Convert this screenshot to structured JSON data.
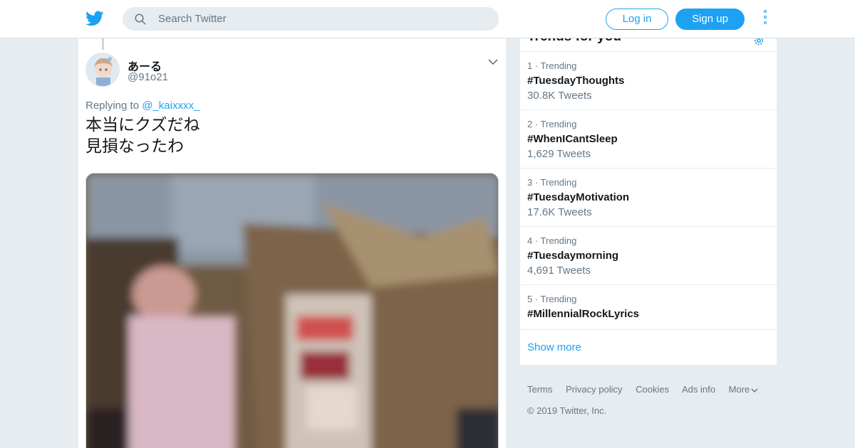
{
  "header": {
    "logo_icon": "twitter-bird-icon",
    "search_placeholder": "Search Twitter",
    "login_label": "Log in",
    "signup_label": "Sign up",
    "accent_color": "#1da1f2"
  },
  "tweet": {
    "display_name": "あーる",
    "handle": "@91o21",
    "replying_prefix": "Replying to",
    "replying_to": "@_kaixxxx_",
    "text_line1": "本当にクズだね",
    "text_line2": "見損なったわ"
  },
  "trends": {
    "title": "Trends for you",
    "items": [
      {
        "meta": "1 · Trending",
        "name": "#TuesdayThoughts",
        "count": "30.8K Tweets"
      },
      {
        "meta": "2 · Trending",
        "name": "#WhenICantSleep",
        "count": "1,629 Tweets"
      },
      {
        "meta": "3 · Trending",
        "name": "#TuesdayMotivation",
        "count": "17.6K Tweets"
      },
      {
        "meta": "4 · Trending",
        "name": "#Tuesdaymorning",
        "count": "4,691 Tweets"
      },
      {
        "meta": "5 · Trending",
        "name": "#MillennialRockLyrics",
        "count": ""
      }
    ],
    "show_more": "Show more"
  },
  "footer": {
    "links": [
      "Terms",
      "Privacy policy",
      "Cookies",
      "Ads info",
      "More"
    ],
    "copyright": "© 2019 Twitter, Inc."
  }
}
